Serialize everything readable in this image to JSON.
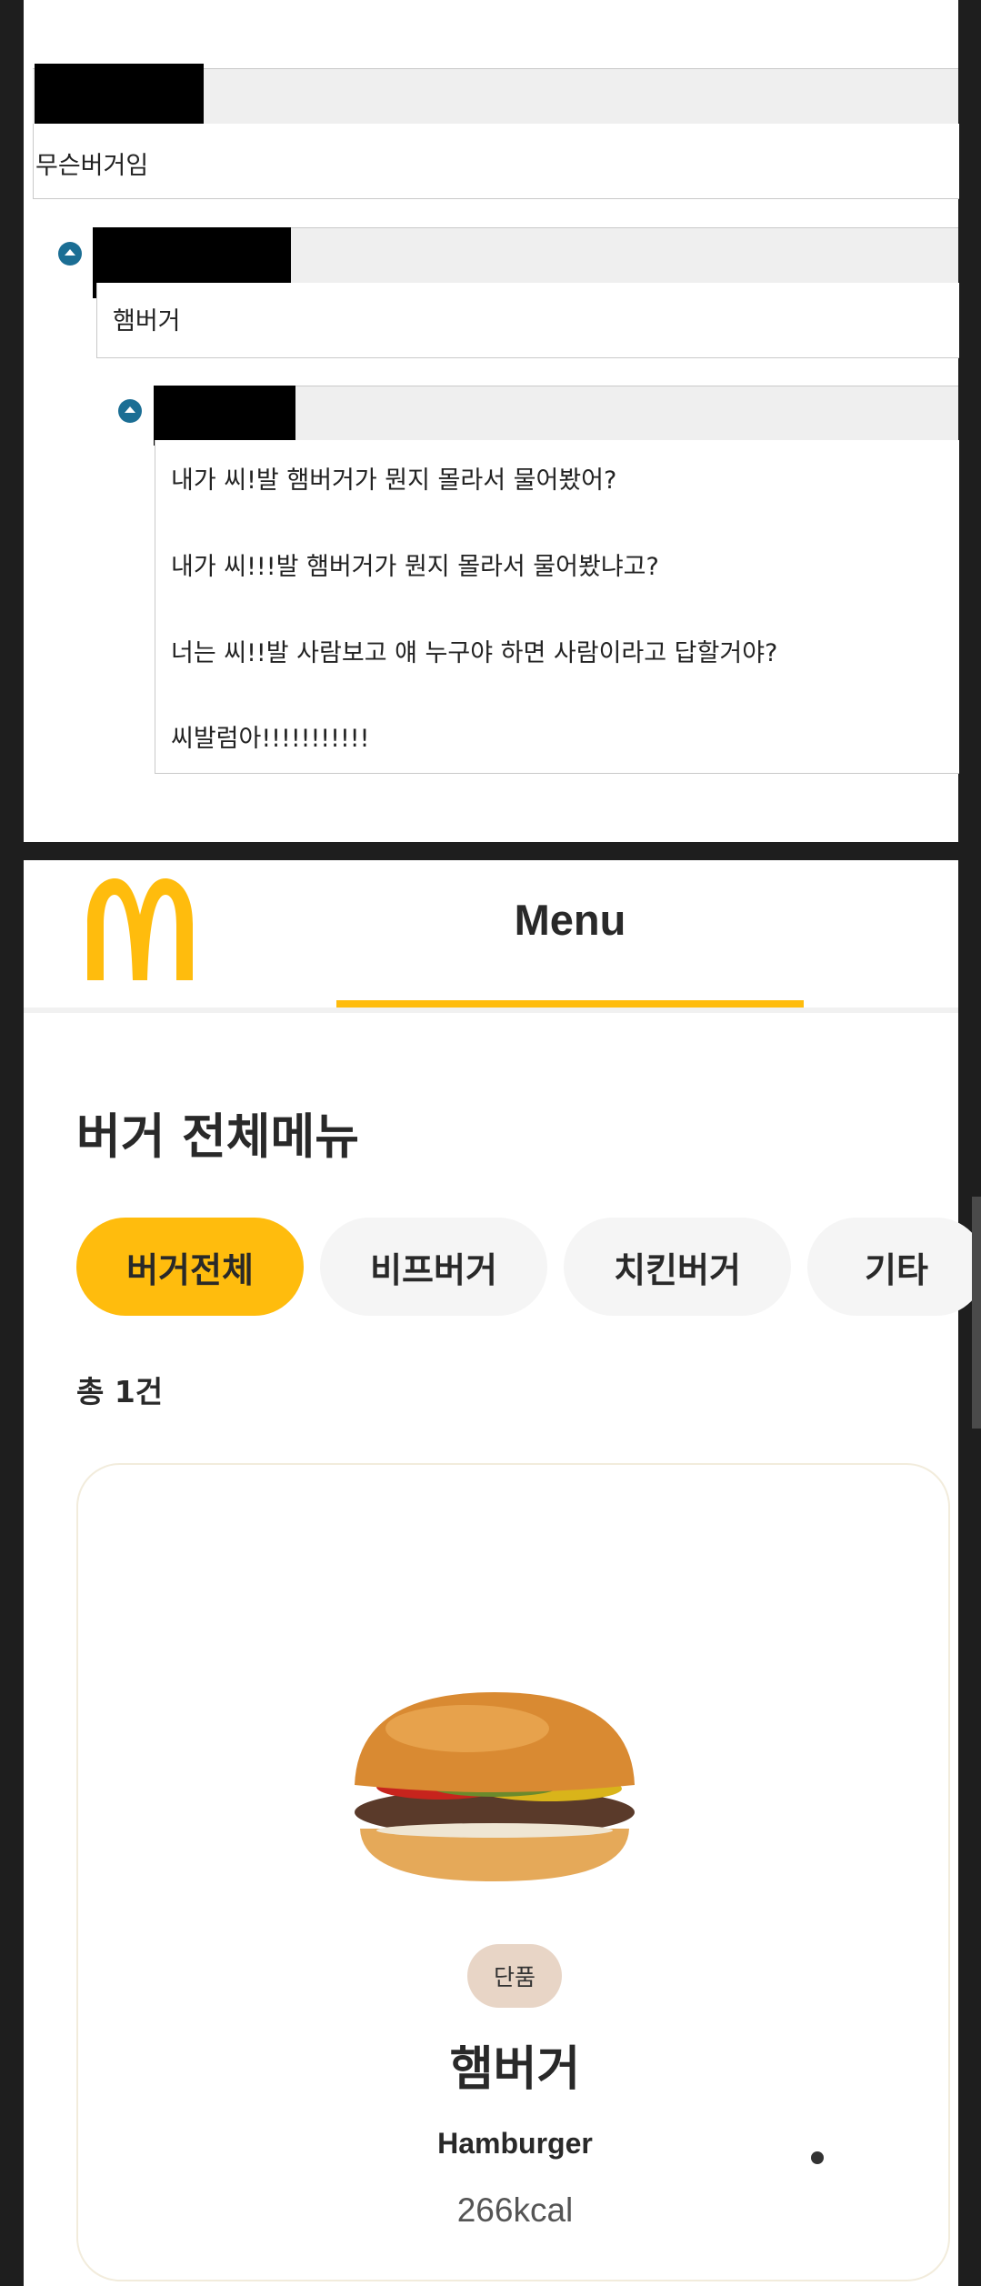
{
  "comments": [
    {
      "text_lines": [
        "무슨버거임"
      ]
    },
    {
      "text_lines": [
        "햄버거"
      ]
    },
    {
      "text_lines": [
        "내가 씨!발 햄버거가 뭔지 몰라서 물어봤어?",
        "내가 씨!!!발 햄버거가 뭔지 몰라서 물어봤냐고?",
        "너는 씨!!발 사람보고 얘 누구야 하면 사람이라고 답할거야?",
        "씨발럼아!!!!!!!!!!!"
      ]
    }
  ],
  "menu_page": {
    "header": {
      "tab_label": "Menu",
      "logo_icon": "mcdonalds-arches-logo",
      "accent_color": "#ffbc0d"
    },
    "section_title": "버거 전체메뉴",
    "categories": [
      {
        "label": "버거전체",
        "active": true
      },
      {
        "label": "비프버거",
        "active": false
      },
      {
        "label": "치킨버거",
        "active": false
      },
      {
        "label": "기타",
        "active": false
      }
    ],
    "count_text": "총 1건",
    "product": {
      "badge": "단품",
      "name_ko": "햄버거",
      "name_en": "Hamburger",
      "kcal": "266kcal",
      "image_icon": "hamburger-image"
    }
  }
}
